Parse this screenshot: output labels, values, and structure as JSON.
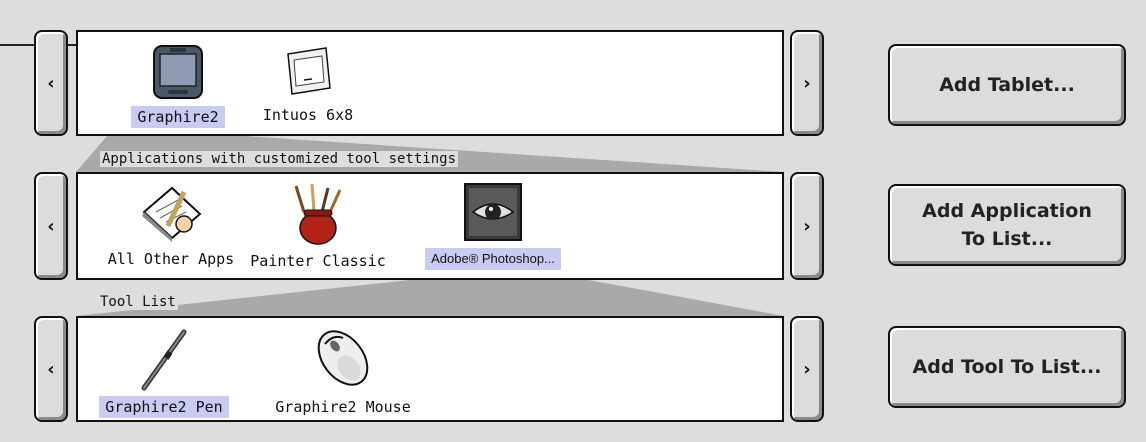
{
  "tablets": {
    "items": [
      {
        "label": "Graphire2",
        "icon": "graphire2-tablet-icon",
        "selected": true
      },
      {
        "label": "Intuos 6x8",
        "icon": "intuos-tablet-icon",
        "selected": false
      }
    ]
  },
  "applications": {
    "section_label": "Applications with customized tool settings",
    "items": [
      {
        "label": "All Other Apps",
        "icon": "all-other-apps-icon",
        "selected": false
      },
      {
        "label": "Painter Classic",
        "icon": "painter-classic-icon",
        "selected": false
      },
      {
        "label": "Adobe® Photoshop...",
        "icon": "photoshop-eye-icon",
        "selected": true
      }
    ]
  },
  "tools": {
    "section_label": "Tool List",
    "items": [
      {
        "label": "Graphire2 Pen",
        "icon": "pen-icon",
        "selected": true
      },
      {
        "label": "Graphire2 Mouse",
        "icon": "mouse-icon",
        "selected": false
      }
    ]
  },
  "nav": {
    "left": "‹",
    "right": "›"
  },
  "buttons": {
    "add_tablet": "Add Tablet...",
    "add_application": "Add Application\nTo List...",
    "add_tool": "Add Tool To  List..."
  },
  "colors": {
    "selection": "#c9cbf2",
    "background": "#dddddd"
  }
}
